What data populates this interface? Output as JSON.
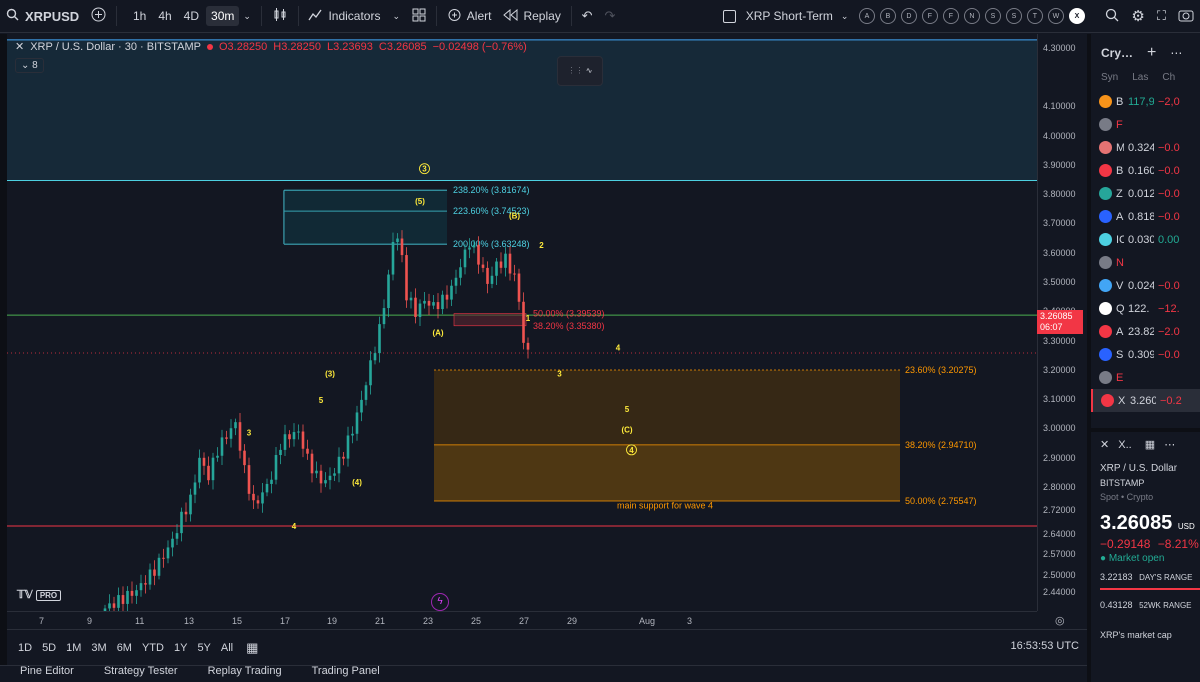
{
  "topbar": {
    "symbol": "XRPUSD",
    "timeframes": [
      "1h",
      "4h",
      "4D",
      "30m"
    ],
    "active_timeframe": "30m",
    "indicators": "Indicators",
    "alert": "Alert",
    "replay": "Replay",
    "layout_name": "XRP Short-Term",
    "letters": [
      "A",
      "B",
      "D",
      "F",
      "F",
      "N",
      "S",
      "S",
      "T",
      "W",
      "X"
    ]
  },
  "legend": {
    "title": "XRP / U.S. Dollar · 30 · BITSTAMP",
    "o": "O3.28250",
    "h": "H3.28250",
    "l": "L3.23693",
    "c": "C3.26085",
    "chg": "−0.02498 (−0.76%)",
    "indicator_count": "8"
  },
  "chart_data": {
    "type": "candlestick",
    "symbol": "XRP / U.S. Dollar",
    "interval": "30",
    "exchange": "BITSTAMP",
    "ylim": [
      2.38,
      4.35
    ],
    "x_ticks": [
      "7",
      "9",
      "11",
      "13",
      "15",
      "17",
      "19",
      "21",
      "23",
      "25",
      "27",
      "29",
      "Aug",
      "3"
    ],
    "y_ticks": [
      "4.30000",
      "4.10000",
      "4.00000",
      "3.90000",
      "3.80000",
      "3.70000",
      "3.60000",
      "3.50000",
      "3.40000",
      "3.30000",
      "3.20000",
      "3.10000",
      "3.00000",
      "2.90000",
      "2.80000",
      "2.72000",
      "2.64000",
      "2.57000",
      "2.50000",
      "2.44000"
    ],
    "price_path": [
      [
        0,
        2.38
      ],
      [
        8,
        2.45
      ],
      [
        12,
        2.52
      ],
      [
        16,
        2.62
      ],
      [
        18,
        2.7
      ],
      [
        20,
        2.76
      ],
      [
        22,
        2.9
      ],
      [
        24,
        2.84
      ],
      [
        26,
        2.93
      ],
      [
        28,
        2.98
      ],
      [
        30,
        3.02
      ],
      [
        32,
        2.86
      ],
      [
        34,
        2.74
      ],
      [
        36,
        2.78
      ],
      [
        38,
        2.84
      ],
      [
        40,
        2.95
      ],
      [
        42,
        2.98
      ],
      [
        44,
        2.99
      ],
      [
        46,
        2.9
      ],
      [
        48,
        2.84
      ],
      [
        50,
        2.82
      ],
      [
        52,
        2.86
      ],
      [
        54,
        2.92
      ],
      [
        56,
        3.0
      ],
      [
        58,
        3.1
      ],
      [
        60,
        3.22
      ],
      [
        62,
        3.34
      ],
      [
        64,
        3.52
      ],
      [
        65,
        3.64
      ],
      [
        66,
        3.66
      ],
      [
        67,
        3.58
      ],
      [
        68,
        3.46
      ],
      [
        70,
        3.4
      ],
      [
        72,
        3.44
      ],
      [
        74,
        3.42
      ],
      [
        76,
        3.44
      ],
      [
        78,
        3.48
      ],
      [
        80,
        3.56
      ],
      [
        82,
        3.64
      ],
      [
        84,
        3.58
      ],
      [
        86,
        3.5
      ],
      [
        88,
        3.56
      ],
      [
        90,
        3.58
      ],
      [
        92,
        3.52
      ],
      [
        93,
        3.44
      ],
      [
        94,
        3.3
      ],
      [
        95,
        3.26
      ]
    ],
    "horizontal_lines": [
      {
        "price": 4.33,
        "color": "#42a5f5"
      },
      {
        "price": 3.85,
        "color": "#4dd0e1"
      },
      {
        "price": 3.39,
        "color": "#4caf50"
      },
      {
        "price": 2.67,
        "color": "#f23645"
      }
    ],
    "fib_upper": [
      {
        "label": "238.20% (3.81674)",
        "price": 3.81674
      },
      {
        "label": "223.60% (3.74523)",
        "price": 3.74523
      },
      {
        "label": "200.00% (3.63248)",
        "price": 3.63248
      }
    ],
    "fib_red": [
      {
        "label": "50.00% (3.39539)",
        "price": 3.39539
      },
      {
        "label": "38.20% (3.35380)",
        "price": 3.3538
      }
    ],
    "fib_lower": [
      {
        "label": "23.60% (3.20275)",
        "price": 3.20275
      },
      {
        "label": "38.20% (2.94710)",
        "price": 2.9471
      },
      {
        "label": "50.00% (2.75547)",
        "price": 2.75547
      }
    ],
    "support_label": "main support for wave 4",
    "wave_labels": [
      {
        "t": "3",
        "x": 32,
        "price": 2.98
      },
      {
        "t": "4",
        "x": 42,
        "price": 2.66
      },
      {
        "t": "5",
        "x": 48,
        "price": 3.09
      },
      {
        "t": "(3)",
        "x": 50,
        "price": 3.18
      },
      {
        "t": "(4)",
        "x": 56,
        "price": 2.81
      },
      {
        "t": "(5)",
        "x": 70,
        "price": 3.77
      },
      {
        "t": "3",
        "x": 71,
        "price": 3.88
      },
      {
        "t": "(A)",
        "x": 74,
        "price": 3.32
      },
      {
        "t": "(B)",
        "x": 91,
        "price": 3.72
      },
      {
        "t": "1",
        "x": 94,
        "price": 3.37
      },
      {
        "t": "2",
        "x": 97,
        "price": 3.62
      },
      {
        "t": "3",
        "x": 101,
        "price": 3.18
      },
      {
        "t": "4",
        "x": 114,
        "price": 3.27
      },
      {
        "t": "5",
        "x": 116,
        "price": 3.06
      },
      {
        "t": "(C)",
        "x": 116,
        "price": 2.99
      },
      {
        "t": "4",
        "x": 117,
        "price": 2.92
      }
    ]
  },
  "price_axis": {
    "current_price": "3.26085",
    "countdown": "06:07"
  },
  "range_bar": {
    "ranges": [
      "1D",
      "5D",
      "1M",
      "3M",
      "6M",
      "YTD",
      "1Y",
      "5Y",
      "All"
    ],
    "clock": "16:53:53 UTC"
  },
  "bottom_tabs": [
    "Pine Editor",
    "Strategy Tester",
    "Replay Trading",
    "Trading Panel"
  ],
  "watchlist": {
    "title": "Cry…",
    "cols": [
      "Syn",
      "Las",
      "Ch"
    ],
    "rows": [
      {
        "s": "B",
        "l": "117,9",
        "c": "−2,0",
        "color": "#f7931a",
        "last_color": "#22ab94"
      },
      {
        "s": "F",
        "l": "",
        "c": "",
        "color": "#787b86",
        "last_color": "#f23645"
      },
      {
        "s": "M",
        "l": "0.324",
        "c": "−0.0",
        "color": "#e57373",
        "last_color": "#d1d4dc"
      },
      {
        "s": "B",
        "l": "0.160",
        "c": "−0.0",
        "color": "#f23645",
        "last_color": "#d1d4dc"
      },
      {
        "s": "Z",
        "l": "0.012",
        "c": "−0.0",
        "color": "#26a69a",
        "last_color": "#d1d4dc"
      },
      {
        "s": "A",
        "l": "0.818",
        "c": "−0.0",
        "color": "#2962ff",
        "last_color": "#d1d4dc"
      },
      {
        "s": "IC",
        "l": "0.030",
        "c": "0.00",
        "color": "#4dd0e1",
        "last_color": "#d1d4dc"
      },
      {
        "s": "N",
        "l": "",
        "c": "",
        "color": "#787b86",
        "last_color": "#f23645"
      },
      {
        "s": "V",
        "l": "0.024",
        "c": "−0.0",
        "color": "#42a5f5",
        "last_color": "#d1d4dc"
      },
      {
        "s": "Q",
        "l": "122.",
        "c": "−12.",
        "color": "#ffffff",
        "last_color": "#d1d4dc"
      },
      {
        "s": "A'",
        "l": "23.82",
        "c": "−2.0",
        "color": "#f23645",
        "last_color": "#d1d4dc"
      },
      {
        "s": "S.",
        "l": "0.309",
        "c": "−0.0",
        "color": "#2962ff",
        "last_color": "#d1d4dc"
      },
      {
        "s": "E",
        "l": "",
        "c": "",
        "color": "#787b86",
        "last_color": "#f23645"
      },
      {
        "s": "X",
        "l": "3.260",
        "c": "−0.2",
        "color": "#f23645",
        "last_color": "#d1d4dc",
        "selected": true
      }
    ]
  },
  "details": {
    "name": "XRP / U.S. Dollar",
    "exchange": "BITSTAMP",
    "type": "Spot • Crypto",
    "price": "3.260",
    "price_tail": "85",
    "currency": "USD",
    "change": "−0.29148",
    "change_pct": "−8.21%",
    "market": "Market open",
    "day_low": "3.22183",
    "day_label": "DAY'S RANGE",
    "wk_low": "0.43128",
    "wk_label": "52WK RANGE",
    "news": "XRP's market cap"
  }
}
